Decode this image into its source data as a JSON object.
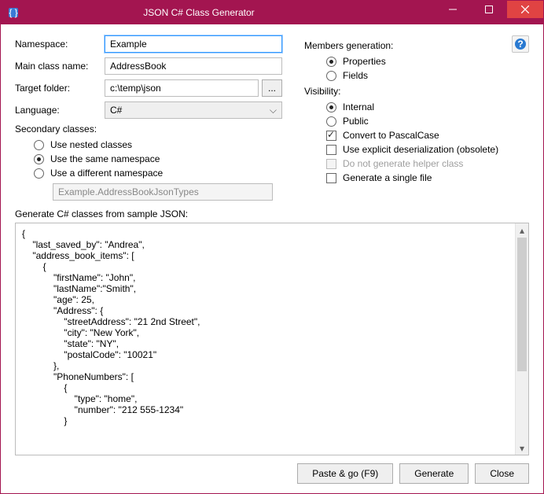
{
  "titlebar": {
    "title": "JSON C# Class Generator"
  },
  "labels": {
    "namespace": "Namespace:",
    "main_class": "Main class name:",
    "target_folder": "Target folder:",
    "language": "Language:",
    "secondary_classes": "Secondary classes:",
    "members_generation": "Members generation:",
    "visibility": "Visibility:",
    "generate_from": "Generate C# classes from sample JSON:",
    "browse": "..."
  },
  "fields": {
    "namespace": "Example",
    "main_class": "AddressBook",
    "target_folder": "c:\\temp\\json",
    "language": "C#",
    "diff_namespace_value": "Example.AddressBookJsonTypes"
  },
  "secondary": {
    "nested": "Use nested classes",
    "same_ns": "Use the same namespace",
    "diff_ns": "Use a different namespace"
  },
  "members": {
    "properties": "Properties",
    "fields": "Fields"
  },
  "visibility": {
    "internal": "Internal",
    "public": "Public"
  },
  "options": {
    "pascal": "Convert to PascalCase",
    "explicit": "Use explicit deserialization (obsolete)",
    "no_helper": "Do not generate helper class",
    "single_file": "Generate a single file"
  },
  "buttons": {
    "paste_go": "Paste & go (F9)",
    "generate": "Generate",
    "close": "Close"
  },
  "json_sample": "{\n    \"last_saved_by\": \"Andrea\",\n    \"address_book_items\": [\n        {\n            \"firstName\": \"John\",\n            \"lastName\":\"Smith\",\n            \"age\": 25,\n            \"Address\": {\n                \"streetAddress\": \"21 2nd Street\",\n                \"city\": \"New York\",\n                \"state\": \"NY\",\n                \"postalCode\": \"10021\"\n            },\n            \"PhoneNumbers\": [\n                {\n                    \"type\": \"home\",\n                    \"number\": \"212 555-1234\"\n                }"
}
